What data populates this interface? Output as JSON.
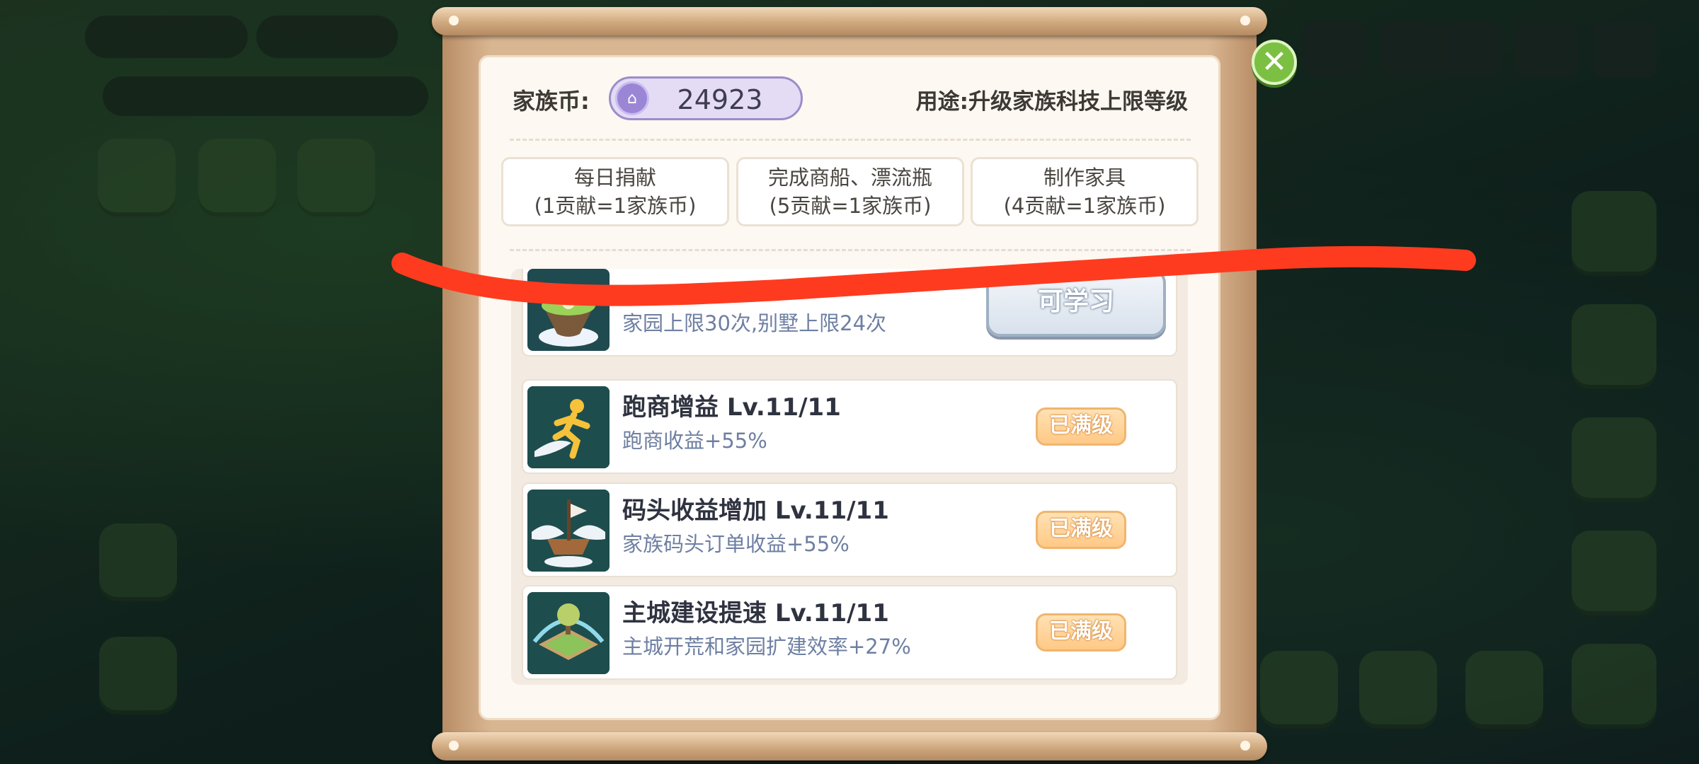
{
  "header": {
    "coin_label": "家族币:",
    "coin_value": "24923",
    "usage_text": "用途:升级家族科技上限等级"
  },
  "sources": [
    {
      "line1": "每日捐献",
      "line2": "(1贡献=1家族币)"
    },
    {
      "line1": "完成商船、漂流瓶",
      "line2": "(5贡献=1家族币)"
    },
    {
      "line1": "制作家具",
      "line2": "(4贡献=1家族币)"
    }
  ],
  "techs": [
    {
      "title": "",
      "desc": "家园上限30次,别墅上限24次",
      "action": "可学习",
      "icon": "floating-island-icon"
    },
    {
      "title": "跑商增益 Lv.11/11",
      "desc": "跑商收益+55%",
      "action": "已满级",
      "icon": "runner-icon"
    },
    {
      "title": "码头收益增加 Lv.11/11",
      "desc": "家族码头订单收益+55%",
      "action": "已满级",
      "icon": "winged-ship-icon"
    },
    {
      "title": "主城建设提速 Lv.11/11",
      "desc": "主城开荒和家园扩建效率+27%",
      "action": "已满级",
      "icon": "island-plot-icon"
    }
  ],
  "colors": {
    "accent_purple": "#9b8dc9",
    "max_badge": "#ffc986",
    "annotation_red": "#ff3b1f"
  }
}
